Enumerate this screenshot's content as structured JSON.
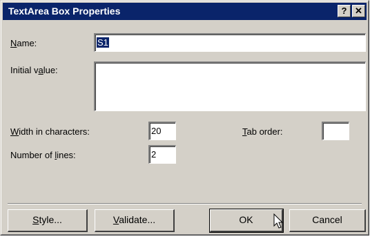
{
  "window": {
    "title": "TextArea Box Properties"
  },
  "titlebar_buttons": {
    "help": "?",
    "close": "✕"
  },
  "form": {
    "name_label_ul": "N",
    "name_label_rest": "ame:",
    "name_value": "S1",
    "initial_label_pre": "Initial v",
    "initial_label_ul": "a",
    "initial_label_rest": "lue:",
    "initial_value": "",
    "width_label_ul": "W",
    "width_label_rest": "idth in characters:",
    "width_value": "20",
    "lines_label_pre": "Number of ",
    "lines_label_ul": "l",
    "lines_label_rest": "ines:",
    "lines_value": "2",
    "tab_label_ul": "T",
    "tab_label_rest": "ab order:",
    "tab_value": ""
  },
  "buttons": {
    "style_ul": "S",
    "style_rest": "tyle...",
    "validate_ul": "V",
    "validate_rest": "alidate...",
    "ok": "OK",
    "cancel": "Cancel"
  }
}
